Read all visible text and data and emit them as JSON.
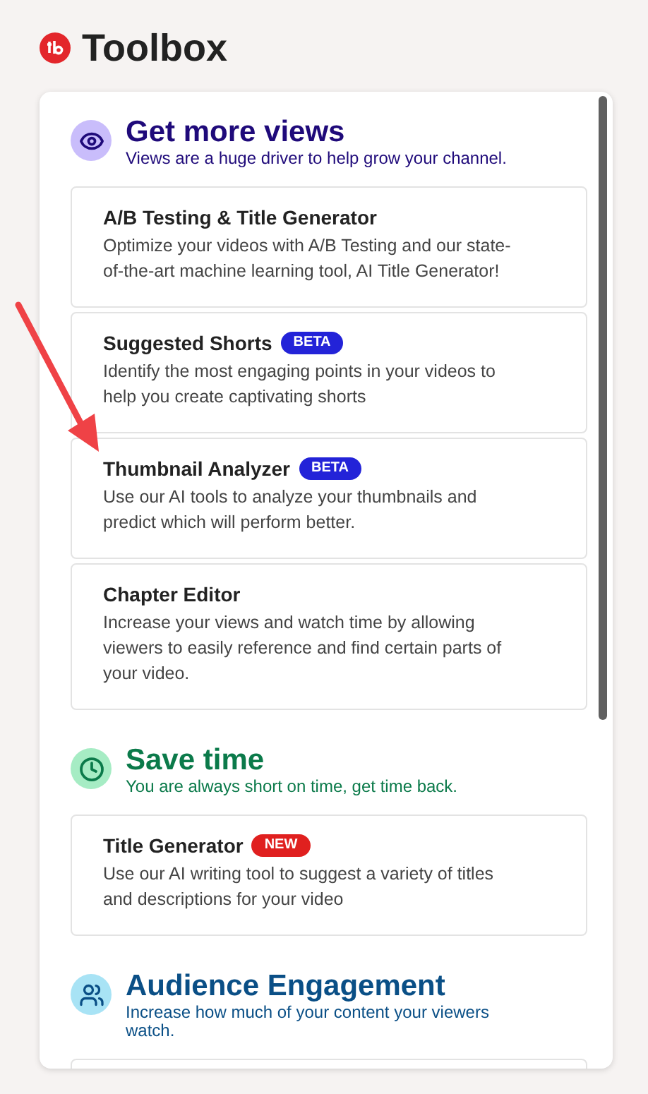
{
  "header": {
    "title": "Toolbox"
  },
  "sections": [
    {
      "kind": "views",
      "color": "#1f0a7a",
      "title": "Get more views",
      "subtitle": "Views are a huge driver to help grow your channel.",
      "tools": [
        {
          "title": "A/B Testing & Title Generator",
          "description": "Optimize your videos with A/B Testing and our state-of-the-art machine learning tool, AI Title Generator!"
        },
        {
          "title": "Suggested Shorts",
          "badge": {
            "kind": "beta",
            "label": "BETA"
          },
          "description": "Identify the most engaging points in your videos to help you create captivating shorts"
        },
        {
          "title": "Thumbnail Analyzer",
          "badge": {
            "kind": "beta",
            "label": "BETA"
          },
          "description": "Use our AI tools to analyze your thumbnails and predict which will perform better."
        },
        {
          "title": "Chapter Editor",
          "description": "Increase your views and watch time by allowing viewers to easily reference and find certain parts of your video."
        }
      ]
    },
    {
      "kind": "time",
      "color": "#0b7a4a",
      "title": "Save time",
      "subtitle": "You are always short on time, get time back.",
      "tools": [
        {
          "title": "Title Generator",
          "badge": {
            "kind": "new",
            "label": "NEW"
          },
          "description": "Use our AI writing tool to suggest a variety of titles and descriptions for your video"
        }
      ]
    },
    {
      "kind": "audience",
      "color": "#0a4f86",
      "title": "Audience Engagement",
      "subtitle": "Increase how much of your content your viewers watch."
    }
  ]
}
